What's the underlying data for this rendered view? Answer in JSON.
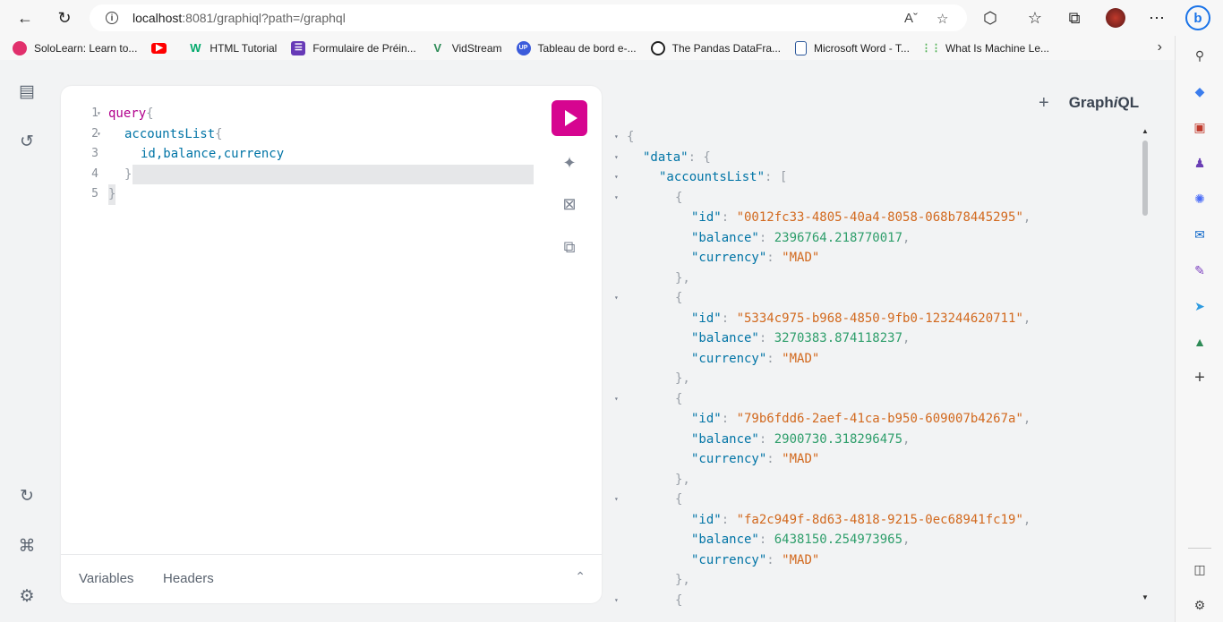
{
  "browser": {
    "url_host": "localhost",
    "url_rest": ":8081/graphiql?path=/graphql",
    "bookmarks": [
      {
        "label": "SoloLearn: Learn to...",
        "icon": "sololearn-icon",
        "color": "#e1306c"
      },
      {
        "label": "",
        "icon": "youtube-icon",
        "color": "#ff0000"
      },
      {
        "label": "HTML Tutorial",
        "icon": "w3schools-icon",
        "color": "#04aa6d"
      },
      {
        "label": "Formulaire de Préin...",
        "icon": "forms-icon",
        "color": "#673ab7"
      },
      {
        "label": "VidStream",
        "icon": "vidstream-icon",
        "color": "#2e8b57"
      },
      {
        "label": "Tableau de bord e-...",
        "icon": "dashboard-icon",
        "color": "#3b5bdb"
      },
      {
        "label": "The Pandas DataFra...",
        "icon": "pandas-icon",
        "color": "#222222"
      },
      {
        "label": "Microsoft Word - T...",
        "icon": "document-icon",
        "color": "#2b579a"
      },
      {
        "label": "What Is Machine Le...",
        "icon": "chart-icon",
        "color": "#4caf50"
      }
    ]
  },
  "editor": {
    "lines": [
      {
        "n": "1",
        "fold": "▾"
      },
      {
        "n": "2",
        "fold": "▾"
      },
      {
        "n": "3",
        "fold": ""
      },
      {
        "n": "4",
        "fold": ""
      },
      {
        "n": "5",
        "fold": ""
      }
    ],
    "tokens": {
      "query": "query",
      "brace_open": "{",
      "accountsList": "accountsList",
      "fields": "id,balance,currency",
      "brace_close": "}"
    },
    "footer_tabs": {
      "variables": "Variables",
      "headers": "Headers"
    }
  },
  "result_header": {
    "plus": "+",
    "brand_pre": "Graph",
    "brand_i": "i",
    "brand_post": "QL"
  },
  "result": {
    "data_key": "\"data\"",
    "list_key": "\"accountsList\"",
    "accounts": [
      {
        "id": "\"0012fc33-4805-40a4-8058-068b78445295\"",
        "balance": "2396764.218770017",
        "currency": "\"MAD\""
      },
      {
        "id": "\"5334c975-b968-4850-9fb0-123244620711\"",
        "balance": "3270383.874118237",
        "currency": "\"MAD\""
      },
      {
        "id": "\"79b6fdd6-2aef-41ca-b950-609007b4267a\"",
        "balance": "2900730.318296475",
        "currency": "\"MAD\""
      },
      {
        "id": "\"fa2c949f-8d63-4818-9215-0ec68941fc19\"",
        "balance": "6438150.254973965",
        "currency": "\"MAD\""
      }
    ],
    "key_id": "\"id\"",
    "key_balance": "\"balance\"",
    "key_currency": "\"currency\""
  }
}
